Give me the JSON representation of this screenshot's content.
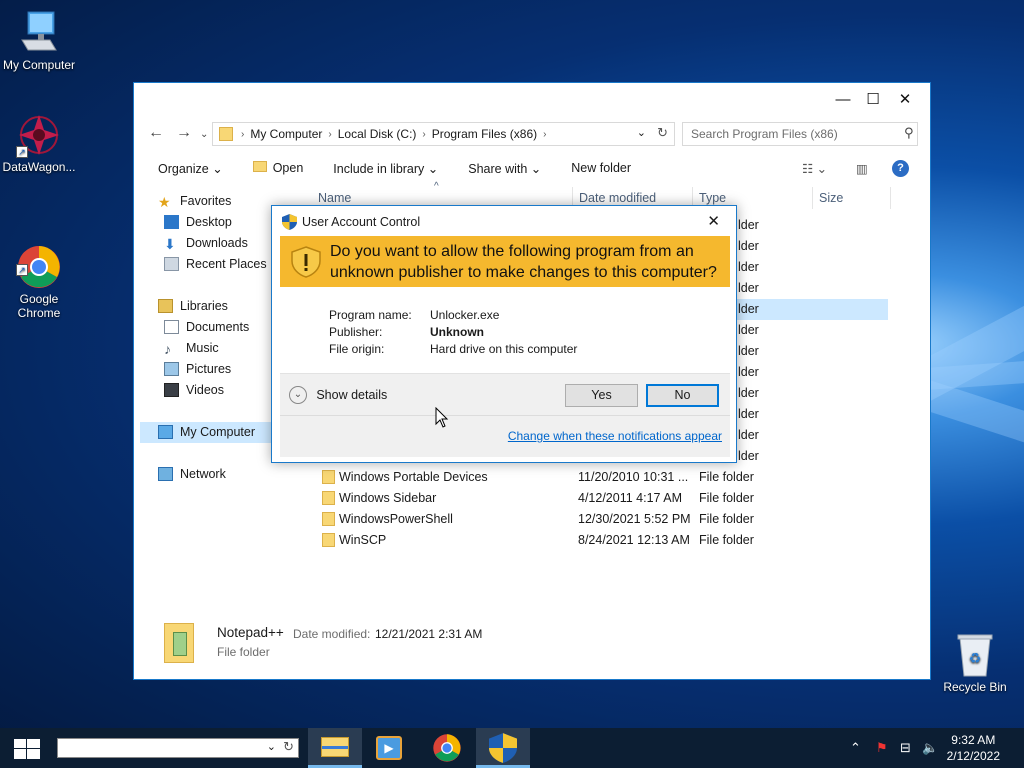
{
  "desktop": {
    "icons": [
      {
        "label": "My Computer"
      },
      {
        "label": "DataWagon..."
      },
      {
        "label": "Google\nChrome"
      },
      {
        "label": "Recycle Bin"
      }
    ]
  },
  "explorer": {
    "address": {
      "crumbs": [
        "My Computer",
        "Local Disk (C:)",
        "Program Files (x86)"
      ]
    },
    "search_placeholder": "Search Program Files (x86)",
    "toolbar": {
      "organize": "Organize",
      "open": "Open",
      "include": "Include in library",
      "share": "Share with",
      "new_folder": "New folder"
    },
    "tree": {
      "favorites": "Favorites",
      "fav_items": [
        "Desktop",
        "Downloads",
        "Recent Places"
      ],
      "libraries": "Libraries",
      "lib_items": [
        "Documents",
        "Music",
        "Pictures",
        "Videos"
      ],
      "computer": "My Computer",
      "network": "Network"
    },
    "columns": {
      "name": "Name",
      "date": "Date modified",
      "type": "Type",
      "size": "Size"
    },
    "partial_type": "lder",
    "rows": [
      {
        "name": "Windows Portable Devices",
        "date": "11/20/2010 10:31 ...",
        "type": "File folder"
      },
      {
        "name": "Windows Sidebar",
        "date": "4/12/2011 4:17 AM",
        "type": "File folder"
      },
      {
        "name": "WindowsPowerShell",
        "date": "12/30/2021 5:52 PM",
        "type": "File folder"
      },
      {
        "name": "WinSCP",
        "date": "8/24/2021 12:13 AM",
        "type": "File folder"
      }
    ],
    "details": {
      "name": "Notepad++",
      "date_label": "Date modified:",
      "date": "12/21/2021 2:31 AM",
      "type": "File folder"
    }
  },
  "uac": {
    "title": "User Account Control",
    "question": "Do you want to allow the following program from an unknown publisher to make changes to this computer?",
    "program_label": "Program name:",
    "program_value": "Unlocker.exe",
    "publisher_label": "Publisher:",
    "publisher_value": "Unknown",
    "origin_label": "File origin:",
    "origin_value": "Hard drive on this computer",
    "show_details": "Show details",
    "yes": "Yes",
    "no": "No",
    "change_link": "Change when these notifications appear",
    "banner_color": "#f5b82e"
  },
  "taskbar": {
    "time": "9:32 AM",
    "date": "2/12/2022"
  }
}
